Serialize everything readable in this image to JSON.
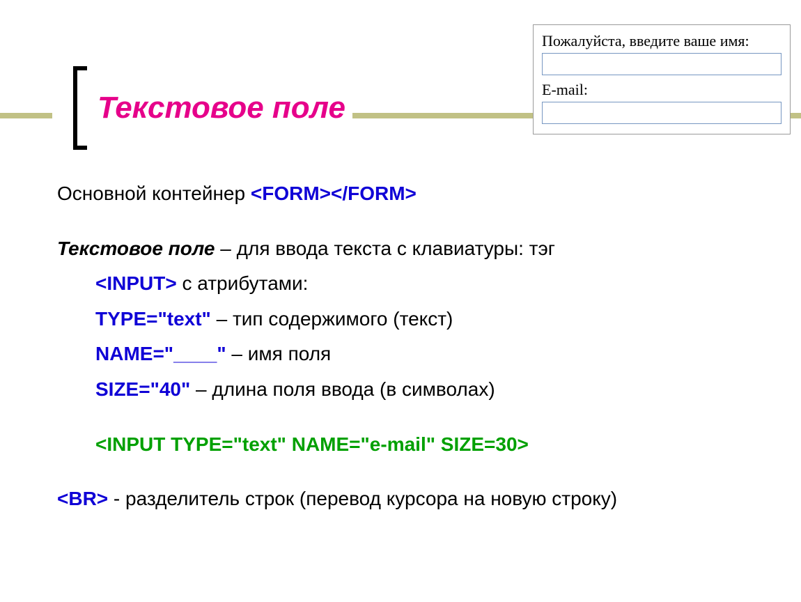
{
  "title": "Текстовое поле",
  "form_preview": {
    "label_name": "Пожалуйста, введите ваше имя:",
    "label_email": "E-mail:"
  },
  "body": {
    "line1_pre": "Основной контейнер ",
    "line1_tag": "<FORM></FORM>",
    "para2_bold": "Текстовое поле",
    "para2_rest": " – для ввода текста с клавиатуры: тэг ",
    "para2_input": "<INPUT>",
    "para2_tail": " с атрибутами:",
    "attr_type_k": "TYPE=\"text\"",
    "attr_type_v": " – тип содержимого (текст)",
    "attr_name_k": "NAME=\"____\"",
    "attr_name_v": " – имя поля",
    "attr_size_k": "SIZE=\"40\"",
    "attr_size_v": " – длина поля ввода (в символах)",
    "example": "<INPUT   TYPE=\"text\"   NAME=\"e-mail\"   SIZE=30>",
    "br_tag": "<BR>",
    "br_text": " - разделитель строк (перевод курсора на новую строку)"
  }
}
